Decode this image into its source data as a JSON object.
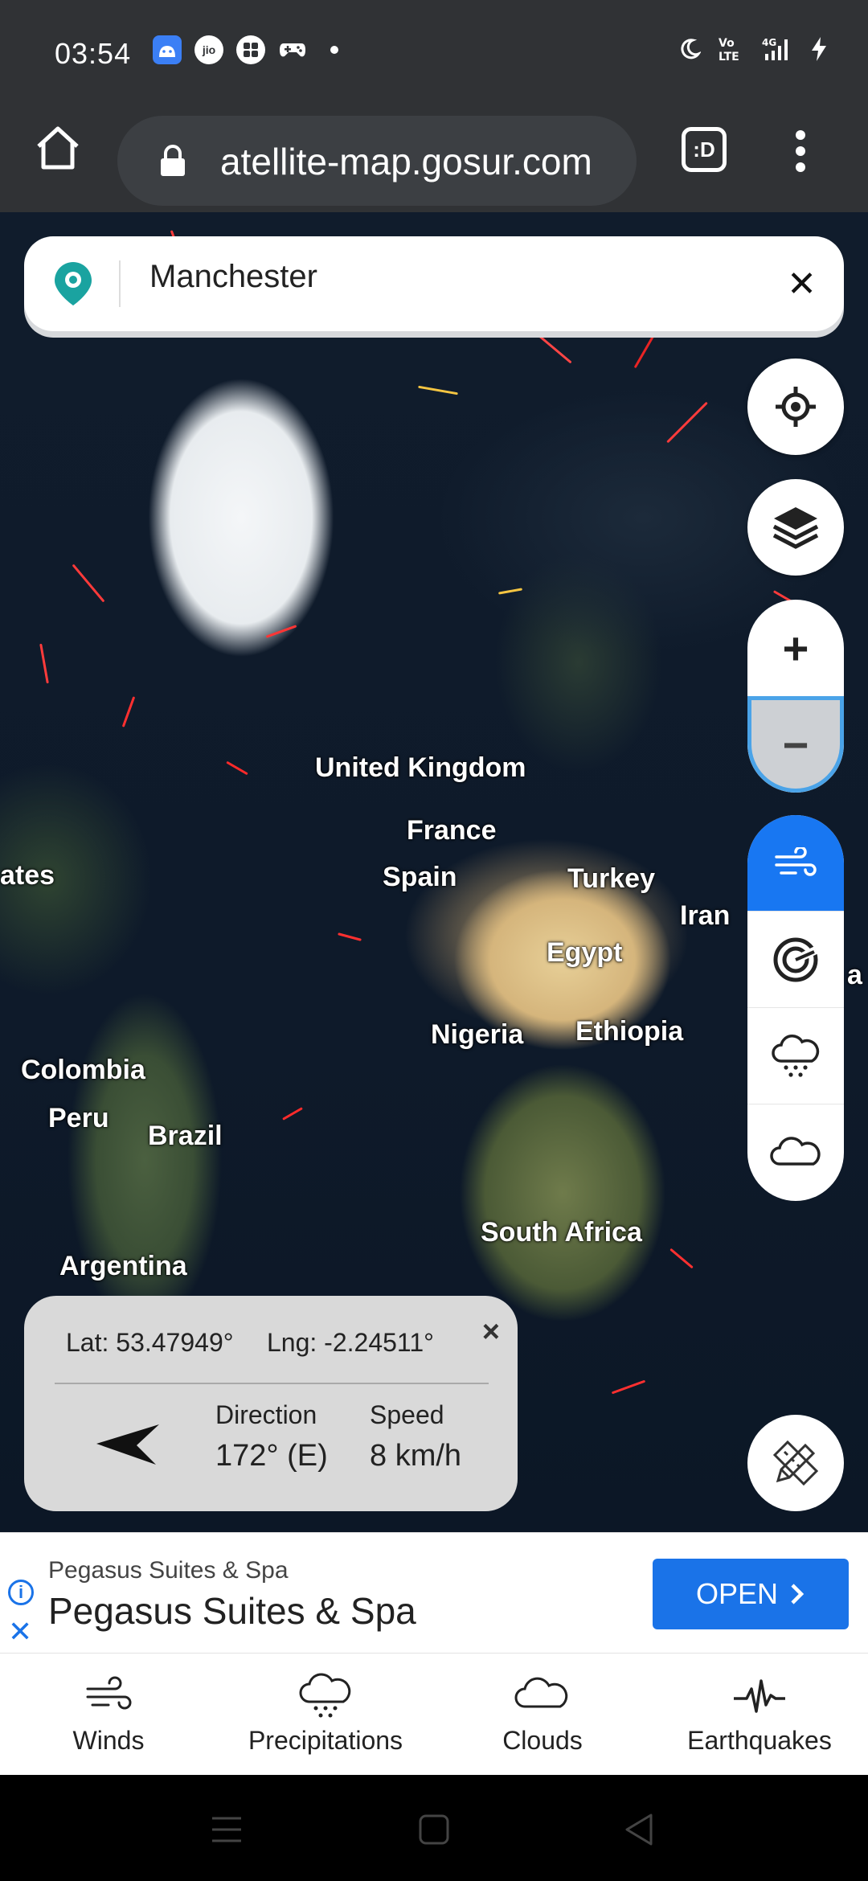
{
  "status_bar": {
    "time": "03:54",
    "icons_left": [
      "android-icon",
      "jio-icon",
      "app-icon",
      "gamepad-icon",
      "dot-icon"
    ],
    "icons_right": [
      "moon-icon",
      "volte-icon",
      "signal-4g-icon",
      "charging-icon"
    ]
  },
  "browser": {
    "url": "atellite-map.gosur.com",
    "tabs_label": ":D"
  },
  "search": {
    "value": "Manchester"
  },
  "map_labels": [
    {
      "text": "United Kingdom"
    },
    {
      "text": "France"
    },
    {
      "text": "Spain"
    },
    {
      "text": "Turkey"
    },
    {
      "text": "Iran"
    },
    {
      "text": "Egypt"
    },
    {
      "text": "Nigeria"
    },
    {
      "text": "Ethiopia"
    },
    {
      "text": "Colombia"
    },
    {
      "text": "Peru"
    },
    {
      "text": "Brazil"
    },
    {
      "text": "South Africa"
    },
    {
      "text": "Argentina"
    },
    {
      "text": "ates"
    },
    {
      "text": "a"
    }
  ],
  "zoom": {
    "in_label": "+",
    "out_label": "−"
  },
  "info": {
    "lat": "Lat: 53.47949°",
    "lng": "Lng: -2.24511°",
    "close": "×",
    "direction_label": "Direction",
    "direction_value": "172° (E)",
    "speed_label": "Speed",
    "speed_value": "8 km/h"
  },
  "ad": {
    "small": "Pegasus Suites & Spa",
    "big": "Pegasus Suites & Spa",
    "button": "OPEN",
    "info_glyph": "i",
    "close_glyph": "✕"
  },
  "bottom_nav": [
    {
      "label": "Winds",
      "icon": "wind-icon"
    },
    {
      "label": "Precipitations",
      "icon": "rain-cloud-icon"
    },
    {
      "label": "Clouds",
      "icon": "cloud-icon"
    },
    {
      "label": "Earthquakes",
      "icon": "seismograph-icon"
    }
  ],
  "colors": {
    "chrome_bg": "#303235",
    "accent_blue": "#1877f2",
    "search_pin": "#1aa3a0"
  }
}
